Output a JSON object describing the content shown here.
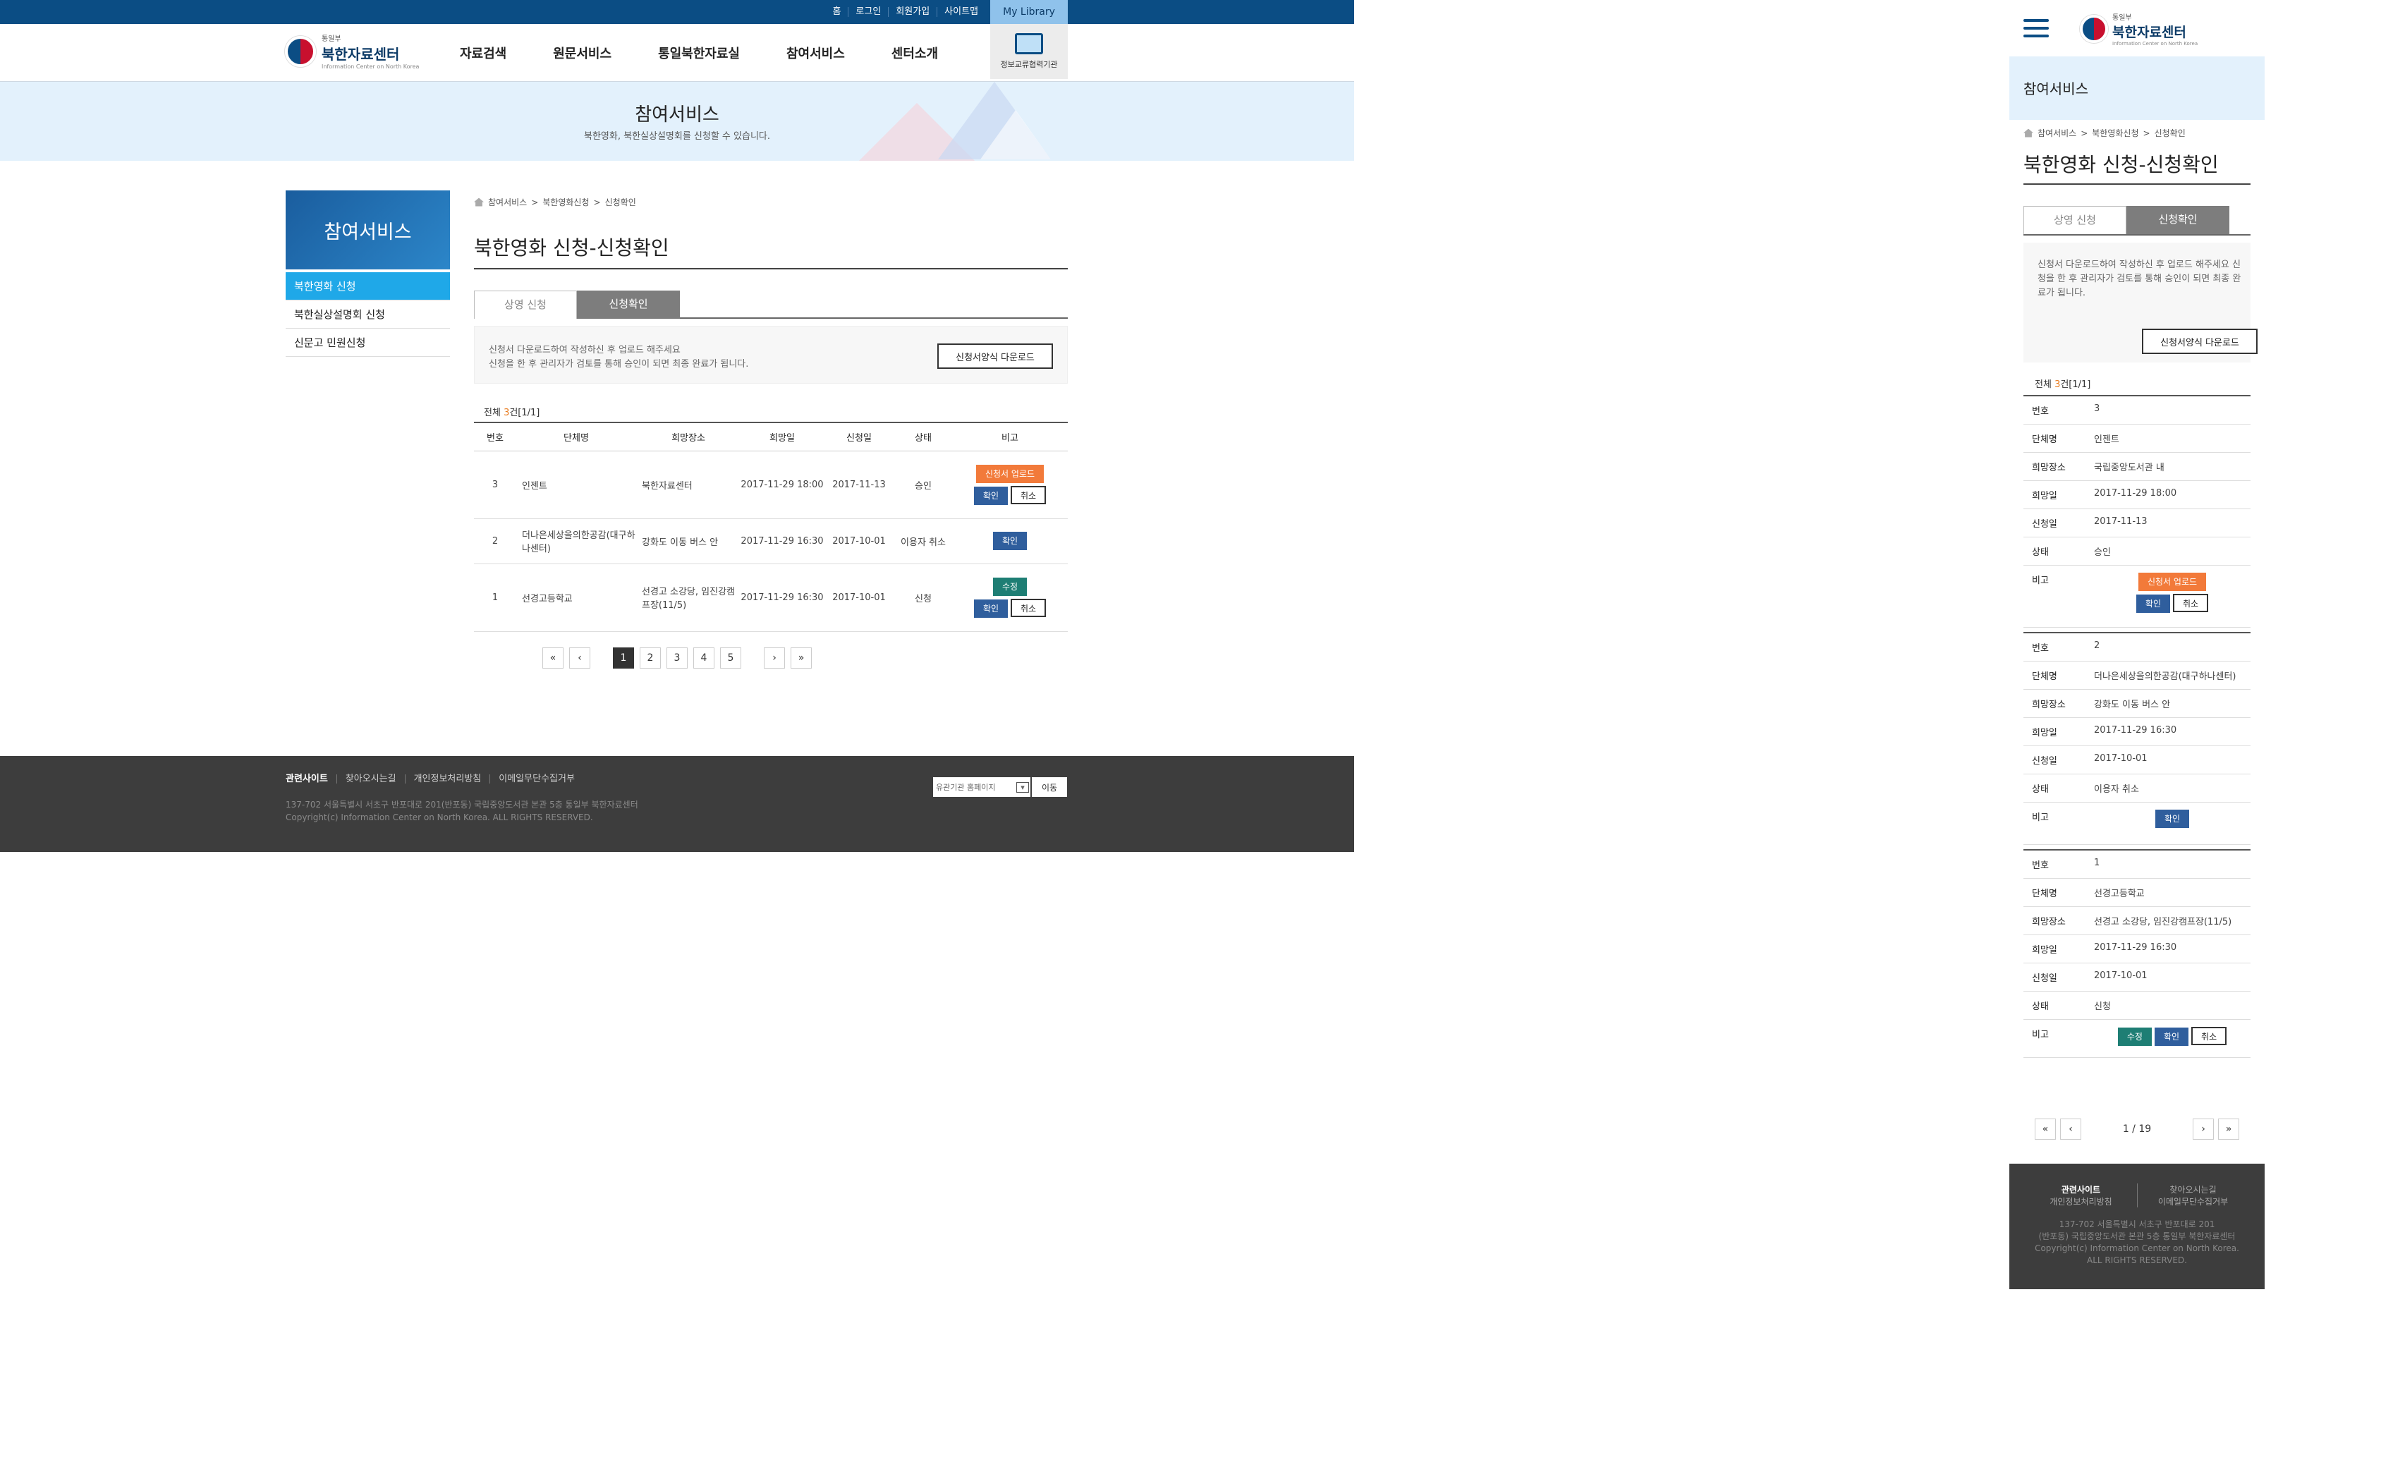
{
  "top_links": [
    "홈",
    "로그인",
    "회원가입",
    "사이트맵"
  ],
  "my_library": "My Library",
  "logo": {
    "small": "통일부",
    "name": "북한자료센터",
    "english": "Information Center on North Korea"
  },
  "gnb": [
    "자료검색",
    "원문서비스",
    "통일북한자료실",
    "참여서비스",
    "센터소개"
  ],
  "info_button": "정보교류협력기관",
  "banner": {
    "title": "참여서비스",
    "subtitle": "북한영화, 북한실상설명회를 신청할 수 있습니다."
  },
  "lnb": {
    "title": "참여서비스",
    "items": [
      "북한영화 신청",
      "북한실상설명회 신청",
      "신문고 민원신청"
    ]
  },
  "breadcrumb": [
    "참여서비스",
    "북한영화신청",
    "신청확인"
  ],
  "page_title": "북한영화 신청-신청확인",
  "tabs": [
    "상영 신청",
    "신청확인"
  ],
  "notice": {
    "line1": "신청서 다운로드하여 작성하신 후 업로드 해주세요",
    "line2": "신청을 한 후 관리자가 검토를 통해 승인이 되면 최종 완료가 됩니다.",
    "mobile_text": "신청서 다운로드하여 작성하신 후 업로드 해주세요 신청을 한 후 관리자가 검토를 통해 승인이 되면 최종 완료가 됩니다.",
    "download": "신청서양식 다운로드"
  },
  "total": {
    "prefix": "전체 ",
    "count": "3",
    "suffix": "건[1/1]"
  },
  "columns": [
    "번호",
    "단체명",
    "희망장소",
    "희망일",
    "신청일",
    "상태",
    "비고"
  ],
  "rows": [
    {
      "no": "3",
      "org": "인젠트",
      "place": "북한자료센터",
      "place_mobile": "국립중앙도서관 내",
      "hope": "2017-11-29 18:00",
      "apply": "2017-11-13",
      "status": "승인"
    },
    {
      "no": "2",
      "org": "더나은세상을의한공감(대구하나센터)",
      "place": "강화도 이동 버스 안",
      "hope": "2017-11-29 16:30",
      "apply": "2017-10-01",
      "status": "이용자 취소"
    },
    {
      "no": "1",
      "org": "선경고등학교",
      "place": "선경고 소강당, 임진강캠프장(11/5)",
      "hope": "2017-11-29 16:30",
      "apply": "2017-10-01",
      "status": "신청"
    }
  ],
  "buttons": {
    "upload": "신청서 업로드",
    "confirm": "확인",
    "cancel": "취소",
    "edit": "수정"
  },
  "pages": [
    "1",
    "2",
    "3",
    "4",
    "5"
  ],
  "mobile_page_info": "1 / 19",
  "footer": {
    "links": [
      "관련사이트",
      "찾아오시는길",
      "개인정보처리방침",
      "이메일무단수집거부"
    ],
    "address": "137-702 서울특별시 서초구 반포대로 201(반포동) 국립중앙도서관 본관 5층 통일부 북한자료센터",
    "copyright": "Copyright(c) Information Center on North Korea. ALL RIGHTS RESERVED.",
    "select": "유관기관 홈페이지",
    "go": "이동",
    "mobile_address1": "137-702 서울특별시 서초구 반포대로 201",
    "mobile_address2": "(반포동) 국립중앙도서관 본관 5층 통일부 북한자료센터",
    "mobile_copy1": "Copyright(c) Information Center on North Korea.",
    "mobile_copy2": "ALL RIGHTS RESERVED."
  },
  "colors": {
    "accent": "#0b4d84",
    "active": "#1fa8e8",
    "orange": "#f27a3a",
    "blue_btn": "#2f5e9d",
    "green_btn": "#1e7e74"
  }
}
